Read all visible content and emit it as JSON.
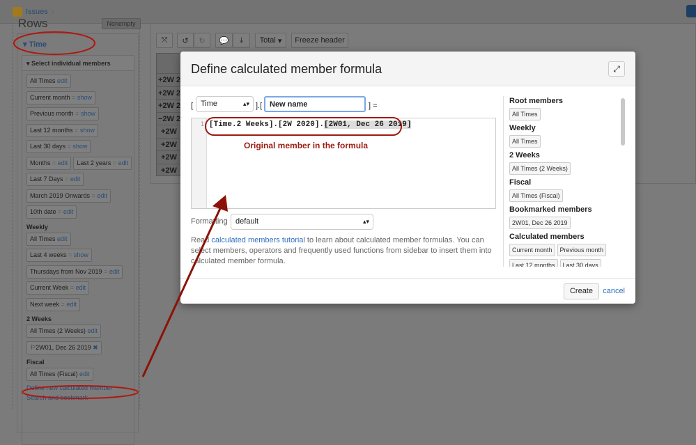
{
  "breadcrumb": {
    "label": "Issues"
  },
  "rows": {
    "title": "Rows",
    "nonempty_label": "Nonempty"
  },
  "time": {
    "label": "Time",
    "section": "Select individual members",
    "groups": [
      {
        "name": "",
        "items": [
          {
            "label": "All Times",
            "action": "edit",
            "eq": false
          },
          {
            "label": "Current month",
            "action": "show",
            "eq": true
          },
          {
            "label": "Previous month",
            "action": "show",
            "eq": true
          },
          {
            "label": "Last 12 months",
            "action": "show",
            "eq": true
          },
          {
            "label": "Last 30 days",
            "action": "show",
            "eq": true
          },
          {
            "label": "Months",
            "action": "edit",
            "eq": true
          },
          {
            "label": "Last 2 years",
            "action": "edit",
            "eq": true
          },
          {
            "label": "Last 7 Days",
            "action": "edit",
            "eq": true
          },
          {
            "label": "March 2019 Onwards",
            "action": "edit",
            "eq": true
          },
          {
            "label": "10th date",
            "action": "edit",
            "eq": true
          }
        ]
      },
      {
        "name": "Weekly",
        "items": [
          {
            "label": "All Times",
            "action": "edit",
            "eq": false
          },
          {
            "label": "Last 4 weeks",
            "action": "show",
            "eq": true
          },
          {
            "label": "Thursdays from Nov 2019",
            "action": "edit",
            "eq": true
          },
          {
            "label": "Current Week",
            "action": "edit",
            "eq": true
          },
          {
            "label": "Next week",
            "action": "edit",
            "eq": true
          }
        ]
      },
      {
        "name": "2 Weeks",
        "items": [
          {
            "label": "All Times (2 Weeks)",
            "action": "edit",
            "eq": false
          },
          {
            "label": "2W01, Dec 26 2019",
            "action": "✖",
            "eq": false,
            "bookmark": true
          }
        ]
      },
      {
        "name": "Fiscal",
        "items": [
          {
            "label": "All Times (Fiscal)",
            "action": "edit",
            "eq": false
          }
        ]
      }
    ],
    "define_link": "Define new calculated member",
    "search_link": "Search and bookmark"
  },
  "toolbar": {
    "total_label": "Total",
    "freeze_label": "Freeze header"
  },
  "table": {
    "rows": [
      "+2W 2",
      "+2W 2",
      "+2W 2",
      "−2W 2",
      "+2W",
      "+2W",
      "+2W",
      "+2W"
    ]
  },
  "modal": {
    "title": "Define calculated member formula",
    "dimension": "Time",
    "name_value": "New name",
    "eq_label": "] =",
    "line_number": "1",
    "formula_prefix": "[Time.2 Weeks].[2W 2020].",
    "formula_member": "[2W01, Dec 26 2019]",
    "annotation": "Original member in the formula",
    "formatting_label": "Formatting",
    "formatting_value": "default",
    "help_pre": "Read ",
    "help_link": "calculated members tutorial",
    "help_post": " to learn about calculated member formulas. You can select members, operators and frequently used functions from sidebar to insert them into calculated member formula.",
    "sidebar": [
      {
        "title": "Root members",
        "items": [
          "All Times"
        ]
      },
      {
        "title": "Weekly",
        "items": [
          "All Times"
        ]
      },
      {
        "title": "2 Weeks",
        "items": [
          "All Times (2 Weeks)"
        ]
      },
      {
        "title": "Fiscal",
        "items": [
          "All Times (Fiscal)"
        ]
      },
      {
        "title": "Bookmarked members",
        "items": [
          "2W01, Dec 26 2019"
        ]
      },
      {
        "title": "Calculated members",
        "items": [
          "Current month",
          "Previous month",
          "Last 12 months",
          "Last 30 days"
        ]
      }
    ],
    "create_label": "Create",
    "cancel_label": "cancel"
  },
  "colors": {
    "annotation": "#9c1c12",
    "link": "#2f6fbf"
  }
}
